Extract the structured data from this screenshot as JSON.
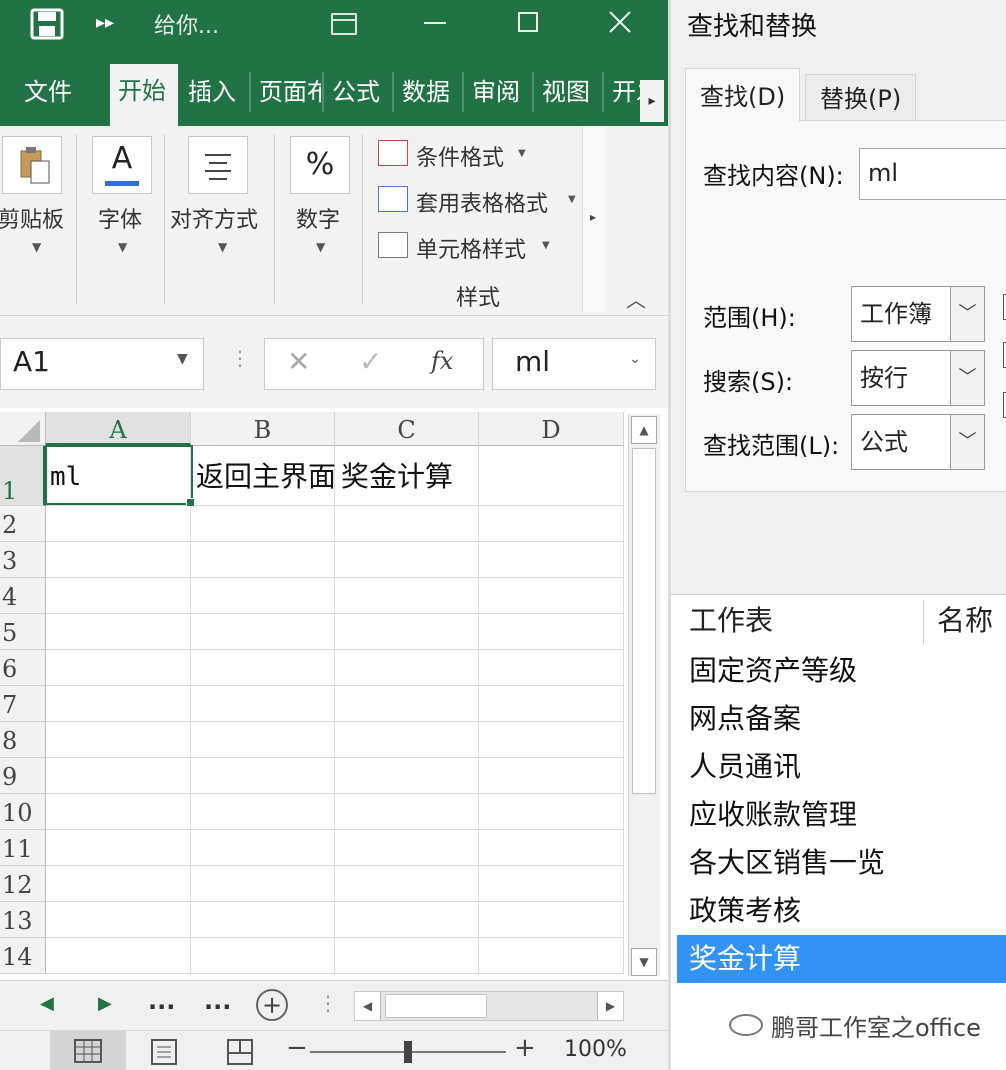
{
  "titlebar": {
    "title": "给你..."
  },
  "ribbon": {
    "tabs": [
      "文件",
      "开始",
      "插入",
      "页面布",
      "公式",
      "数据",
      "审阅",
      "视图",
      "开发"
    ],
    "groups": {
      "clipboard": "剪贴板",
      "font": "字体",
      "alignment": "对齐方式",
      "number": "数字",
      "styles": "样式"
    },
    "styles_items": [
      "条件格式",
      "套用表格格式",
      "单元格样式"
    ],
    "font_icon": "A",
    "number_icon": "%"
  },
  "formula_bar": {
    "name_box": "A1",
    "fx": "fx",
    "content": "ml"
  },
  "sheet": {
    "columns": [
      "A",
      "B",
      "C",
      "D"
    ],
    "rows": [
      "1",
      "2",
      "3",
      "4",
      "5",
      "6",
      "7",
      "8",
      "9",
      "10",
      "11",
      "12",
      "13",
      "14"
    ],
    "cells": {
      "A1": "ml",
      "B1": "返回主界面",
      "C1": "奖金计算"
    },
    "nav_more_left": "...",
    "nav_more_right": "..."
  },
  "status": {
    "zoom": "100%"
  },
  "dialog": {
    "title": "查找和替换",
    "tabs": {
      "find": "查找(D)",
      "replace": "替换(P)"
    },
    "find_label": "查找内容(N):",
    "find_value": "ml",
    "within_label": "范围(H):",
    "within_value": "工作簿",
    "search_label": "搜索(S):",
    "search_value": "按行",
    "lookin_label": "查找范围(L):",
    "lookin_value": "公式",
    "results_headers": {
      "sheet": "工作表",
      "name": "名称"
    },
    "results": [
      "固定资产等级",
      "网点备案",
      "人员通讯",
      "应收账款管理",
      "各大区销售一览",
      "政策考核",
      "奖金计算"
    ],
    "selected_index": 6
  },
  "watermark": "鹏哥工作室之office",
  "colors": {
    "excel_green": "#217346",
    "selection_blue": "#3393f5"
  }
}
